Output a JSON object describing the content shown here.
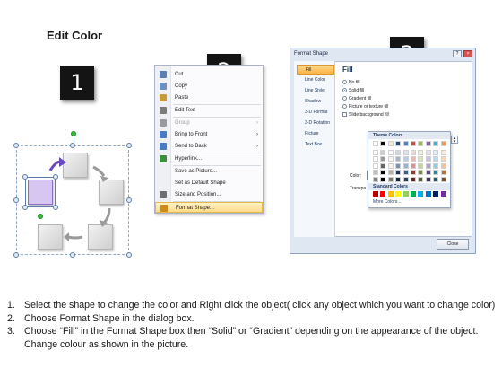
{
  "title": "Edit Color",
  "steps": [
    "1",
    "2",
    "3"
  ],
  "context_menu": {
    "items": [
      {
        "label": "Cut",
        "icon": "scissors-icon",
        "color": "#5a7fb0"
      },
      {
        "label": "Copy",
        "icon": "copy-icon",
        "color": "#6b8fc0"
      },
      {
        "label": "Paste",
        "icon": "paste-icon",
        "color": "#c79a3a"
      },
      {
        "label": "Edit Text",
        "icon": "edit-text-icon",
        "color": "#7c7c7c"
      },
      {
        "label": "Group",
        "icon": "group-icon",
        "color": "#9a9a9a",
        "disabled": true,
        "submenu": true
      },
      {
        "label": "Bring to Front",
        "icon": "bring-to-front-icon",
        "color": "#4a79c5",
        "submenu": true
      },
      {
        "label": "Send to Back",
        "icon": "send-to-back-icon",
        "color": "#4a79c5",
        "submenu": true
      },
      {
        "label": "Hyperlink...",
        "icon": "hyperlink-icon",
        "color": "#3c8d3c"
      },
      {
        "label": "Save as Picture...",
        "icon": "none"
      },
      {
        "label": "Set as Default Shape",
        "icon": "none"
      },
      {
        "label": "Size and Position...",
        "icon": "size-position-icon",
        "color": "#6f6f6f"
      },
      {
        "label": "Format Shape...",
        "icon": "format-shape-icon",
        "color": "#d08a1c",
        "highlight": true
      }
    ]
  },
  "dialog": {
    "title": "Format Shape",
    "nav": [
      "Fill",
      "Line Color",
      "Line Style",
      "Shadow",
      "3-D Format",
      "3-D Rotation",
      "Picture",
      "Text Box"
    ],
    "heading": "Fill",
    "options": [
      {
        "label": "No fill",
        "type": "radio"
      },
      {
        "label": "Solid fill",
        "type": "radio",
        "checked": true
      },
      {
        "label": "Gradient fill",
        "type": "radio"
      },
      {
        "label": "Picture or texture fill",
        "type": "radio"
      },
      {
        "label": "Slide background fill",
        "type": "check"
      }
    ],
    "color_label": "Color:",
    "transparency_label": "Transpa",
    "close_label": "Close",
    "palette": {
      "theme_label": "Theme Colors",
      "standard_label": "Standard Colors",
      "more_label": "More Colors...",
      "theme_top": [
        "#ffffff",
        "#000000",
        "#eeece1",
        "#1f497d",
        "#4f81bd",
        "#c0504d",
        "#9bbb59",
        "#8064a2",
        "#4bacc6",
        "#f79646"
      ],
      "standard": [
        "#c00000",
        "#ff0000",
        "#ffc000",
        "#ffff00",
        "#92d050",
        "#00b050",
        "#00b0f0",
        "#0070c0",
        "#002060",
        "#7030a0"
      ]
    }
  },
  "instructions": [
    {
      "num": "1.",
      "text": "Select the shape to change the color and Right click the object( click any object which you want to change color)"
    },
    {
      "num": "2.",
      "text": "Choose Format Shape in the dialog box."
    },
    {
      "num": "3.",
      "text": "Choose “Fill” in the Format Shape box then “Solid” or “Gradient” depending on the appearance of the object. Change colour as shown in the picture."
    }
  ]
}
